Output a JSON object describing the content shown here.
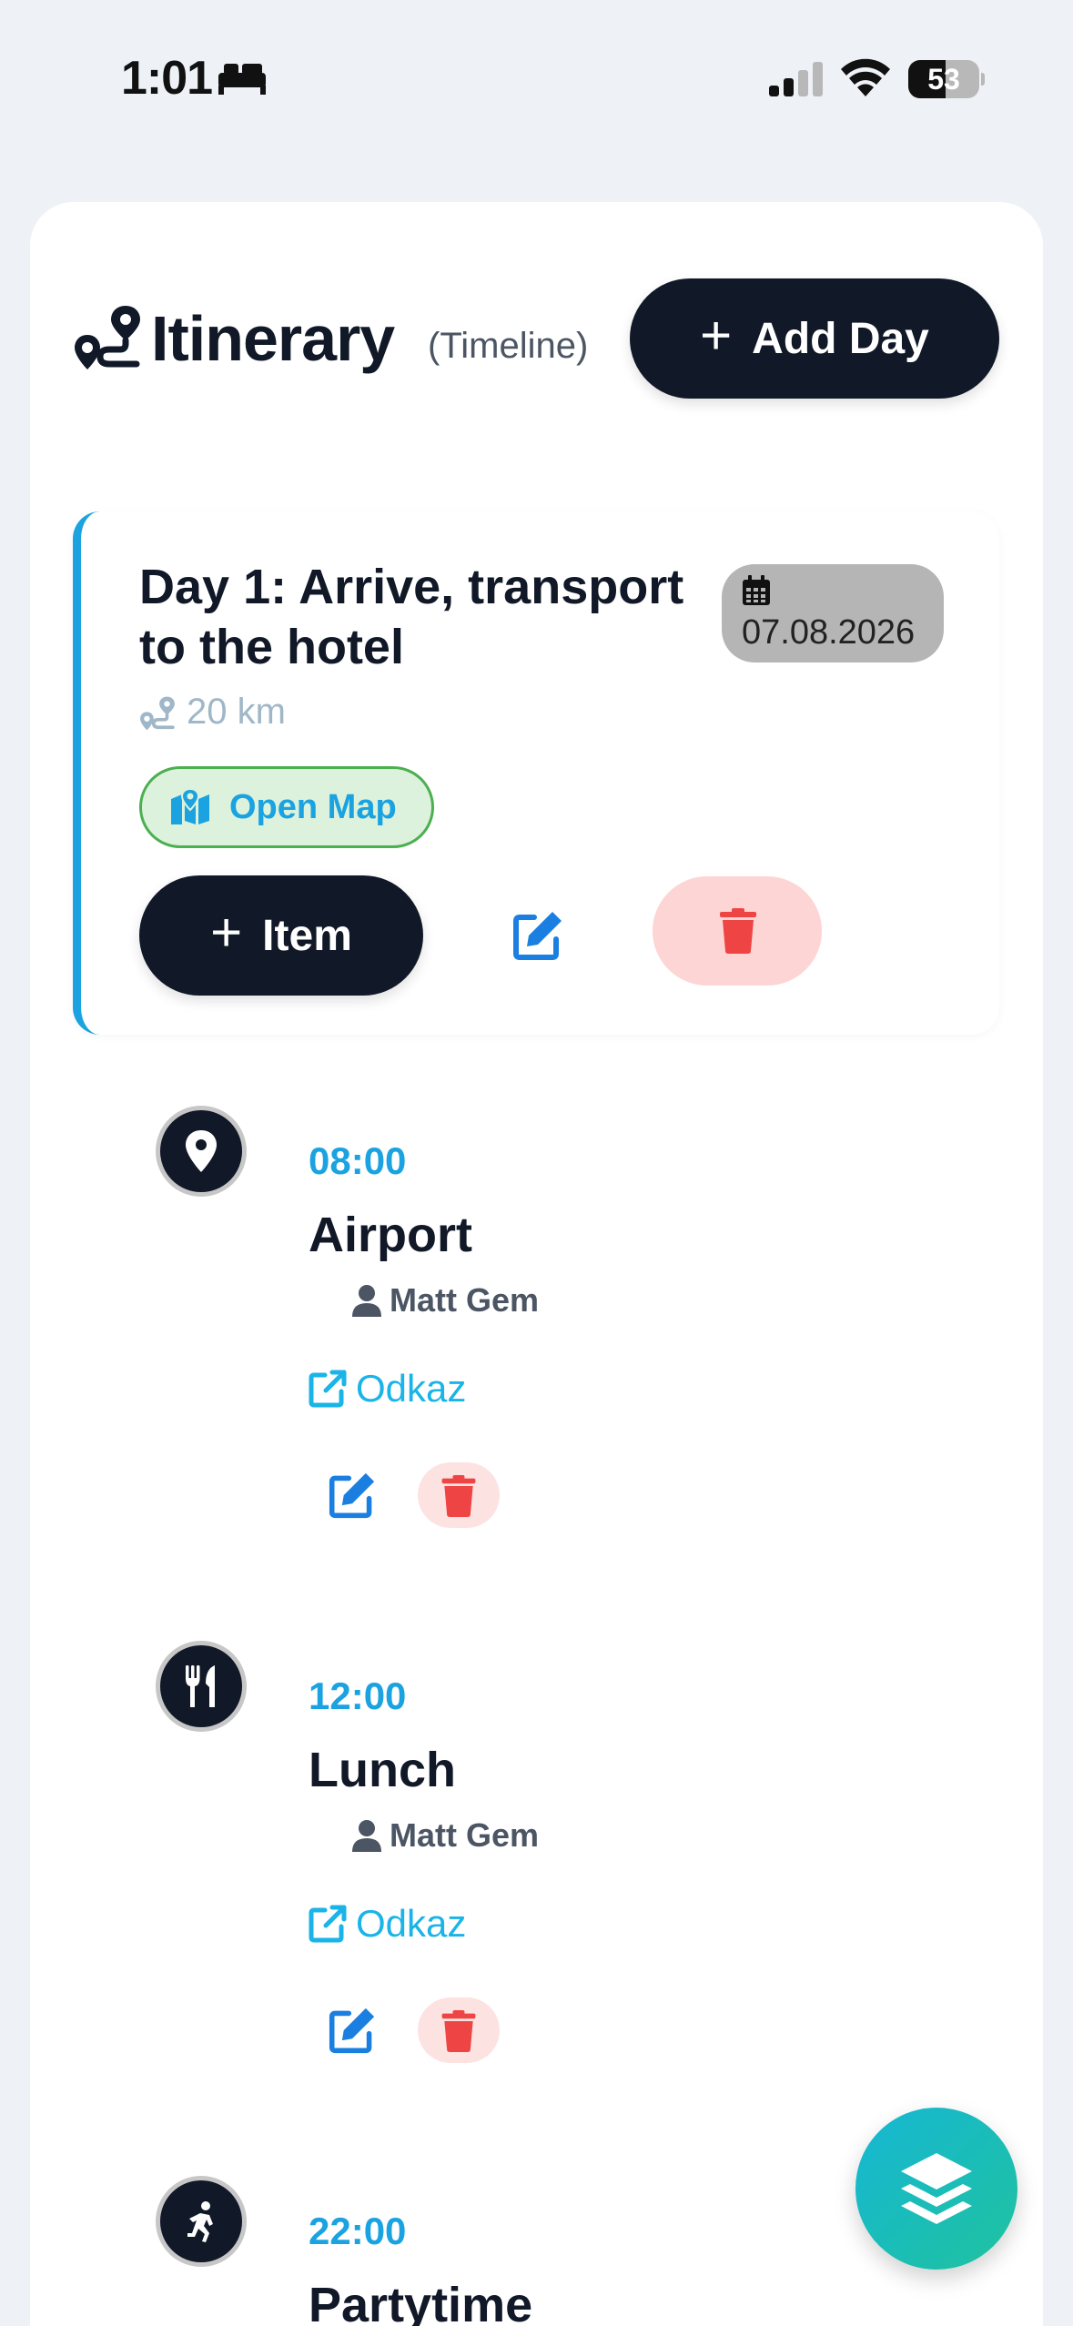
{
  "status_bar": {
    "time": "1:01",
    "battery_level": "53",
    "battery_percent": 53
  },
  "header": {
    "title": "Itinerary",
    "subtitle": "(Timeline)",
    "add_day_label": "Add Day"
  },
  "day": {
    "title": "Day 1: Arrive, transport to the hotel",
    "date": "07.08.2026",
    "distance": "20 km",
    "open_map_label": "Open Map",
    "add_item_label": "Item"
  },
  "entries": [
    {
      "time": "08:00",
      "title": "Airport",
      "person": "Matt Gem",
      "link_label": "Odkaz",
      "icon": "map-pin-icon"
    },
    {
      "time": "12:00",
      "title": "Lunch",
      "person": "Matt Gem",
      "link_label": "Odkaz",
      "icon": "utensils-icon"
    },
    {
      "time": "22:00",
      "title": "Partytime",
      "icon": "running-person-icon"
    }
  ],
  "colors": {
    "accent": "#1aa3e0",
    "dark": "#111827",
    "danger": "#ef4444",
    "danger_bg": "#fdd5d5",
    "map_bg": "#dcf2dc",
    "map_border": "#4caf50"
  }
}
